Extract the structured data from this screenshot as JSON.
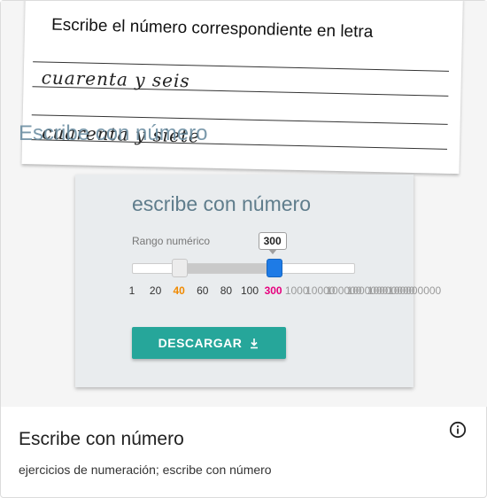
{
  "worksheet": {
    "title": "Escribe el número correspondiente en letra",
    "answers": [
      "cuarenta y seis",
      "cuarenta y siete"
    ]
  },
  "overlay_title": "Escribe con número",
  "widget": {
    "heading": "escribe con número",
    "range_label": "Rango numérico",
    "slider": {
      "low_value": "40",
      "high_value": "300",
      "tooltip": "300",
      "ticks": [
        "1",
        "20",
        "40",
        "60",
        "80",
        "100",
        "300",
        "1000",
        "10000",
        "100000",
        "1000000",
        "10000000",
        "100000000"
      ]
    },
    "download_label": "DESCARGAR",
    "download_icon": "download-arrow-icon"
  },
  "info": {
    "title": "Escribe con número",
    "description": "ejercicios de numeración; escribe con número",
    "icon": "info-icon"
  },
  "colors": {
    "teal_button": "#26a69a",
    "heading": "#5f7d8c",
    "low_value": "#f08a00",
    "high_value": "#e6007e",
    "handle_active": "#1e7be6"
  }
}
